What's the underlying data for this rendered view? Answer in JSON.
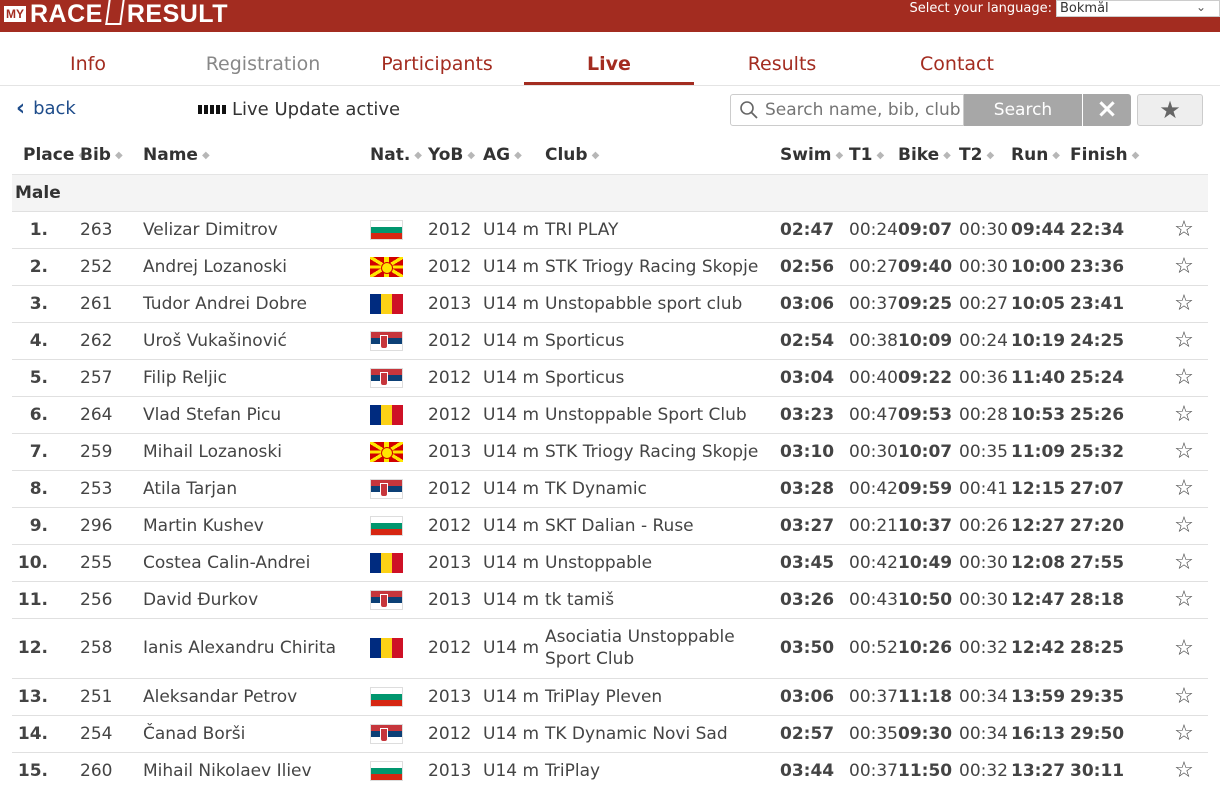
{
  "header": {
    "logo_my": "MY",
    "logo_left": "RACE",
    "logo_right": "RESULT",
    "language_label": "Select your language:",
    "language_value": "Bokmål"
  },
  "tabs": [
    {
      "label": "Info",
      "state": "normal"
    },
    {
      "label": "Registration",
      "state": "disabled"
    },
    {
      "label": "Participants",
      "state": "normal"
    },
    {
      "label": "Live",
      "state": "active"
    },
    {
      "label": "Results",
      "state": "normal"
    },
    {
      "label": "Contact",
      "state": "normal"
    }
  ],
  "toolbar": {
    "back_label": "back",
    "live_label": "Live Update active",
    "search_placeholder": "Search name, bib, club, e",
    "search_button": "Search",
    "clear_icon": "×",
    "favorite_icon": "★"
  },
  "table": {
    "columns": [
      "Place",
      "Bib",
      "Name",
      "Nat.",
      "YoB",
      "AG",
      "Club",
      "Swim",
      "T1",
      "Bike",
      "T2",
      "Run",
      "Finish"
    ],
    "group": "Male",
    "rows": [
      {
        "place": "1.",
        "bib": "263",
        "name": "Velizar Dimitrov",
        "nat": "bg",
        "yob": "2012",
        "ag": "U14 m",
        "club": "TRI PLAY",
        "swim": "02:47",
        "t1": "00:24",
        "bike": "09:07",
        "t2": "00:30",
        "run": "09:44",
        "finish": "22:34"
      },
      {
        "place": "2.",
        "bib": "252",
        "name": "Andrej Lozanoski",
        "nat": "mk",
        "yob": "2012",
        "ag": "U14 m",
        "club": "STK Triogy Racing Skopje",
        "swim": "02:56",
        "t1": "00:27",
        "bike": "09:40",
        "t2": "00:30",
        "run": "10:00",
        "finish": "23:36"
      },
      {
        "place": "3.",
        "bib": "261",
        "name": "Tudor Andrei Dobre",
        "nat": "ro",
        "yob": "2013",
        "ag": "U14 m",
        "club": "Unstopabble sport club",
        "swim": "03:06",
        "t1": "00:37",
        "bike": "09:25",
        "t2": "00:27",
        "run": "10:05",
        "finish": "23:41"
      },
      {
        "place": "4.",
        "bib": "262",
        "name": "Uroš Vukašinović",
        "nat": "rs",
        "yob": "2012",
        "ag": "U14 m",
        "club": "Sporticus",
        "swim": "02:54",
        "t1": "00:38",
        "bike": "10:09",
        "t2": "00:24",
        "run": "10:19",
        "finish": "24:25"
      },
      {
        "place": "5.",
        "bib": "257",
        "name": "Filip Reljic",
        "nat": "rs",
        "yob": "2012",
        "ag": "U14 m",
        "club": "Sporticus",
        "swim": "03:04",
        "t1": "00:40",
        "bike": "09:22",
        "t2": "00:36",
        "run": "11:40",
        "finish": "25:24"
      },
      {
        "place": "6.",
        "bib": "264",
        "name": "Vlad Stefan Picu",
        "nat": "ro",
        "yob": "2012",
        "ag": "U14 m",
        "club": "Unstoppable Sport Club",
        "swim": "03:23",
        "t1": "00:47",
        "bike": "09:53",
        "t2": "00:28",
        "run": "10:53",
        "finish": "25:26"
      },
      {
        "place": "7.",
        "bib": "259",
        "name": "Mihail Lozanoski",
        "nat": "mk",
        "yob": "2013",
        "ag": "U14 m",
        "club": "STK Triogy Racing Skopje",
        "swim": "03:10",
        "t1": "00:30",
        "bike": "10:07",
        "t2": "00:35",
        "run": "11:09",
        "finish": "25:32"
      },
      {
        "place": "8.",
        "bib": "253",
        "name": "Atila Tarjan",
        "nat": "rs",
        "yob": "2012",
        "ag": "U14 m",
        "club": "TK Dynamic",
        "swim": "03:28",
        "t1": "00:42",
        "bike": "09:59",
        "t2": "00:41",
        "run": "12:15",
        "finish": "27:07"
      },
      {
        "place": "9.",
        "bib": "296",
        "name": "Martin Kushev",
        "nat": "bg",
        "yob": "2012",
        "ag": "U14 m",
        "club": "SKT Dalian - Ruse",
        "swim": "03:27",
        "t1": "00:21",
        "bike": "10:37",
        "t2": "00:26",
        "run": "12:27",
        "finish": "27:20"
      },
      {
        "place": "10.",
        "bib": "255",
        "name": "Costea Calin-Andrei",
        "nat": "ro",
        "yob": "2013",
        "ag": "U14 m",
        "club": "Unstoppable",
        "swim": "03:45",
        "t1": "00:42",
        "bike": "10:49",
        "t2": "00:30",
        "run": "12:08",
        "finish": "27:55"
      },
      {
        "place": "11.",
        "bib": "256",
        "name": "David Đurkov",
        "nat": "rs",
        "yob": "2013",
        "ag": "U14 m",
        "club": "tk tamiš",
        "swim": "03:26",
        "t1": "00:43",
        "bike": "10:50",
        "t2": "00:30",
        "run": "12:47",
        "finish": "28:18"
      },
      {
        "place": "12.",
        "bib": "258",
        "name": "Ianis Alexandru Chirita",
        "nat": "ro",
        "yob": "2012",
        "ag": "U14 m",
        "club": "Asociatia Unstoppable Sport Club",
        "swim": "03:50",
        "t1": "00:52",
        "bike": "10:26",
        "t2": "00:32",
        "run": "12:42",
        "finish": "28:25"
      },
      {
        "place": "13.",
        "bib": "251",
        "name": "Aleksandar Petrov",
        "nat": "bg",
        "yob": "2013",
        "ag": "U14 m",
        "club": "TriPlay Pleven",
        "swim": "03:06",
        "t1": "00:37",
        "bike": "11:18",
        "t2": "00:34",
        "run": "13:59",
        "finish": "29:35"
      },
      {
        "place": "14.",
        "bib": "254",
        "name": "Čanad Borši",
        "nat": "rs",
        "yob": "2012",
        "ag": "U14 m",
        "club": "TK Dynamic Novi Sad",
        "swim": "02:57",
        "t1": "00:35",
        "bike": "09:30",
        "t2": "00:34",
        "run": "16:13",
        "finish": "29:50"
      },
      {
        "place": "15.",
        "bib": "260",
        "name": "Mihail Nikolaev Iliev",
        "nat": "bg",
        "yob": "2013",
        "ag": "U14 m",
        "club": "TriPlay",
        "swim": "03:44",
        "t1": "00:37",
        "bike": "11:50",
        "t2": "00:32",
        "run": "13:27",
        "finish": "30:11"
      }
    ]
  },
  "colors": {
    "brand_red": "#a32c20",
    "link_blue": "#1f4d8b",
    "button_gray": "#a7a7a7"
  }
}
